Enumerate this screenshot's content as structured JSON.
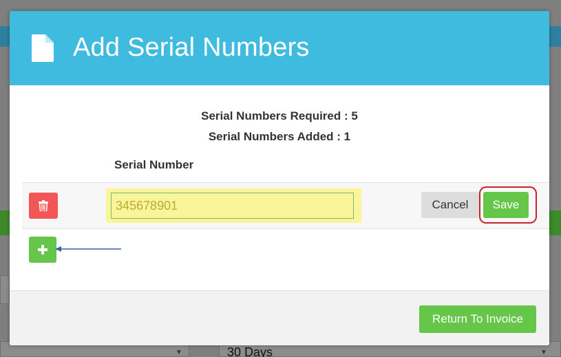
{
  "modal": {
    "title": "Add Serial Numbers",
    "header_color": "#40bbe0",
    "icon": "document-icon"
  },
  "summary": {
    "required_label": "Serial Numbers Required :",
    "required_value": "5",
    "added_label": "Serial Numbers Added :",
    "added_value": "1"
  },
  "table": {
    "column_header": "Serial Number",
    "rows": [
      {
        "serial_value": "345678901",
        "delete_icon": "trash-icon"
      }
    ]
  },
  "buttons": {
    "cancel_label": "Cancel",
    "save_label": "Save",
    "add_icon": "plus-icon",
    "return_label": "Return To Invoice"
  },
  "background": {
    "select_value": "30 Days"
  },
  "colors": {
    "danger": "#f25656",
    "success": "#66c64a",
    "highlight": "#fbf59a",
    "annotation_red": "#c8232b",
    "annotation_arrow": "#3a5fa8"
  }
}
